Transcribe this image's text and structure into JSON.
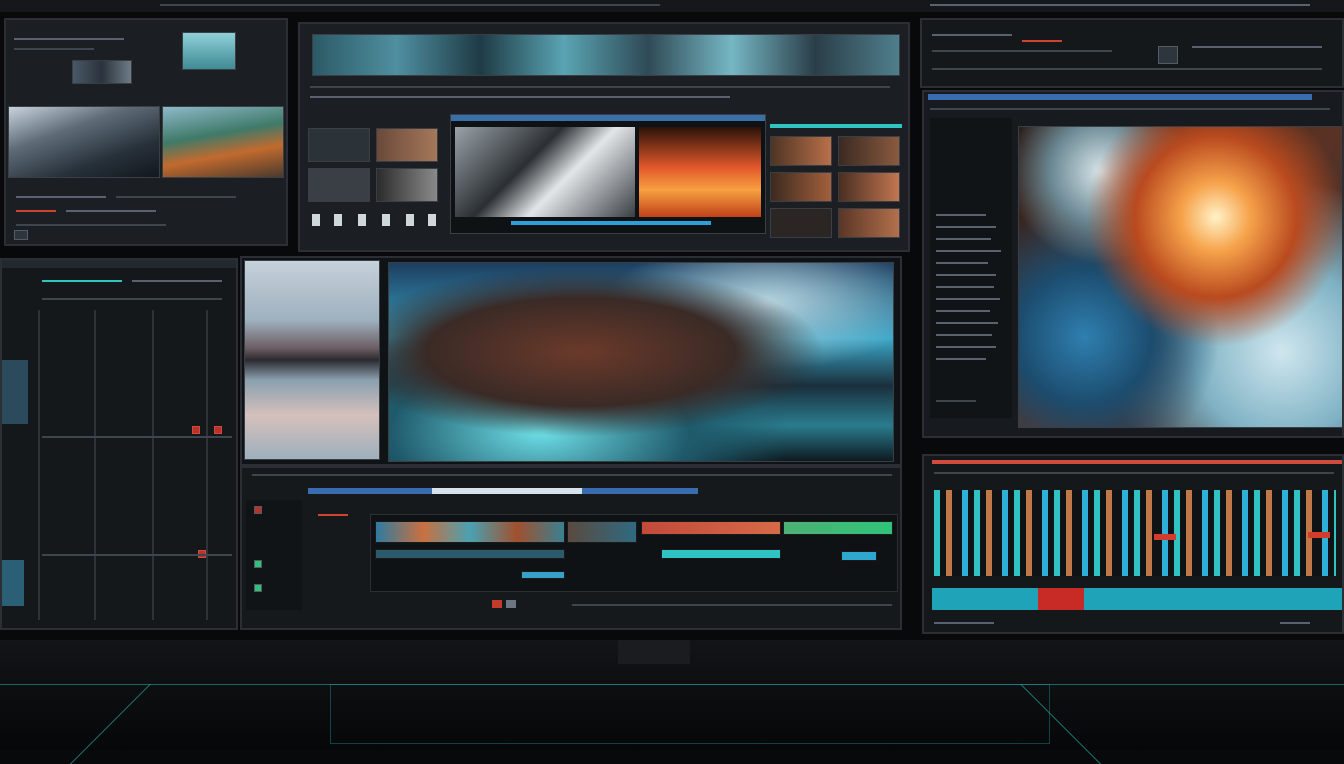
{
  "workspace": {
    "panels": [
      "media-bin",
      "source-browser",
      "scopes",
      "effects-viewer",
      "track-mixer",
      "program-monitor",
      "timeline",
      "audio-meters"
    ]
  },
  "icons": [
    "play-icon",
    "stop-icon",
    "record-icon",
    "settings-icon",
    "grid-icon",
    "wave-icon"
  ],
  "colors": {
    "accent": "#2fc3c4",
    "danger": "#d33b2c",
    "panel": "#1b1e22",
    "timeline_blue": "#3a6db0"
  }
}
